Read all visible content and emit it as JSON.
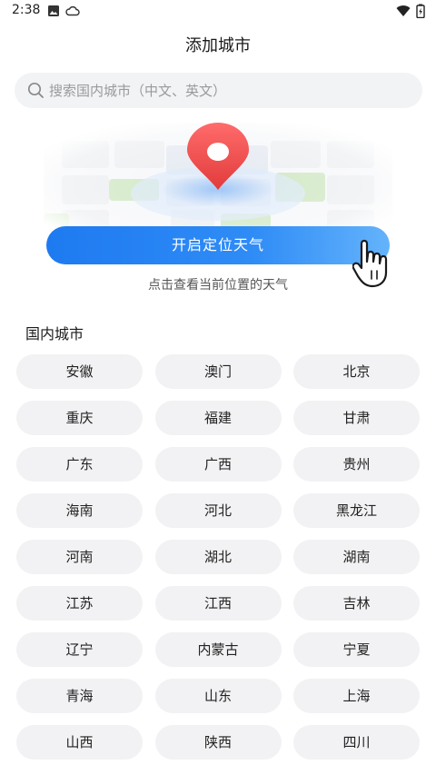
{
  "status_bar": {
    "time": "2:38",
    "left_icons": [
      "image-icon",
      "cloud-icon"
    ],
    "right_icons": [
      "wifi-icon",
      "battery-icon"
    ]
  },
  "header": {
    "title": "添加城市"
  },
  "search": {
    "placeholder": "搜索国内城市（中文、英文）",
    "value": ""
  },
  "locate": {
    "button_label": "开启定位天气",
    "hint": "点击查看当前位置的天气",
    "illustration_icons": [
      "map-pin-icon",
      "hand-pointer-icon"
    ]
  },
  "domestic": {
    "title": "国内城市",
    "cities": [
      "安徽",
      "澳门",
      "北京",
      "重庆",
      "福建",
      "甘肃",
      "广东",
      "广西",
      "贵州",
      "海南",
      "河北",
      "黑龙江",
      "河南",
      "湖北",
      "湖南",
      "江苏",
      "江西",
      "吉林",
      "辽宁",
      "内蒙古",
      "宁夏",
      "青海",
      "山东",
      "上海",
      "山西",
      "陕西",
      "四川"
    ]
  },
  "colors": {
    "accent": "#1e7af0",
    "pin": "#f04a4a",
    "chip_bg": "#f2f2f4"
  }
}
